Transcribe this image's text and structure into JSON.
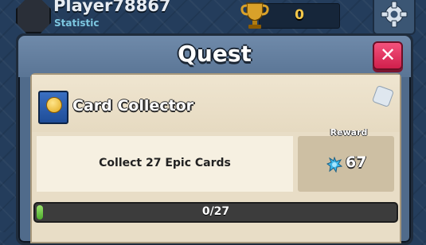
{
  "player": {
    "name": "Player78867",
    "subtitle": "Statistic"
  },
  "trophies": {
    "value": "0",
    "icon": "trophy-icon"
  },
  "settings": {
    "icon": "gear-icon"
  },
  "modal": {
    "title": "Quest",
    "close_icon": "close-icon"
  },
  "quest": {
    "name": "Card Collector",
    "icon": "book-icon",
    "task": "Collect 27 Epic Cards",
    "reward_label": "Reward",
    "reward_value": "67",
    "reward_icon": "gem-icon",
    "progress_text": "0/27",
    "progress_current": 0,
    "progress_total": 27
  },
  "colors": {
    "accent_close": "#e0305c",
    "progress_fill": "#6cc84a",
    "gold": "#f4c84a"
  }
}
